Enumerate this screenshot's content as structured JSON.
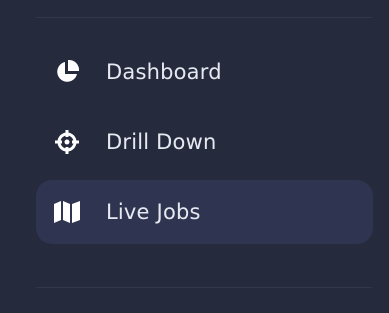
{
  "sidebar": {
    "items": [
      {
        "label": "Dashboard",
        "icon": "pie-chart-icon",
        "active": false
      },
      {
        "label": "Drill Down",
        "icon": "crosshair-icon",
        "active": false
      },
      {
        "label": "Live Jobs",
        "icon": "map-icon",
        "active": true
      }
    ]
  },
  "colors": {
    "background": "#262a3d",
    "active_item_bg": "#2f3550",
    "text": "#e7e9f1",
    "divider": "#323749"
  }
}
